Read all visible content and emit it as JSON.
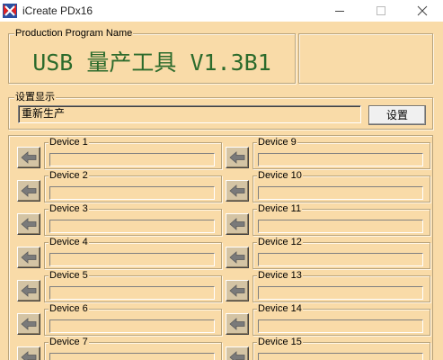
{
  "window": {
    "title": "iCreate PDx16"
  },
  "program": {
    "caption": "Production Program Name",
    "name": "USB 量产工具 V1.3B1"
  },
  "setting": {
    "caption": "设置显示",
    "value": "重新生产",
    "button_label": "设置"
  },
  "devices": {
    "left": [
      "Device 1",
      "Device 2",
      "Device 3",
      "Device 4",
      "Device 5",
      "Device 6",
      "Device 7"
    ],
    "right": [
      "Device 9",
      "Device 10",
      "Device 11",
      "Device 12",
      "Device 13",
      "Device 14",
      "Device 15"
    ]
  },
  "icons": {
    "app": "app-icon",
    "minimize": "minimize-icon",
    "maximize": "maximize-icon",
    "close": "close-icon",
    "device_action": "left-arrow-icon"
  },
  "colors": {
    "background": "#f9dba8",
    "program_text": "#2c6b2c"
  }
}
